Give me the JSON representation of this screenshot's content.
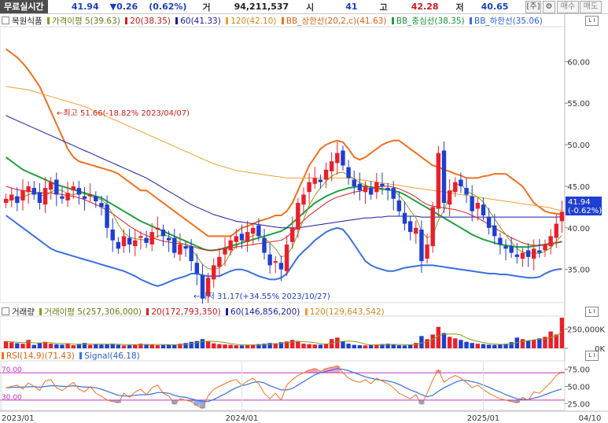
{
  "header": {
    "live_label": "무료실시간",
    "price": "41.94",
    "change": "▼0.26",
    "change_pct": "(0.62%)",
    "volume_label": "거",
    "volume": "94,211,537",
    "open_label": "시",
    "open": "41",
    "high_label": "고",
    "high": "42.28",
    "low_label": "저",
    "low": "40.65",
    "period_btn": "[주]",
    "settings_btn": "⚙",
    "buy_btn": "매수",
    "sell_btn": "매도"
  },
  "price_legend": {
    "name": "목원식품",
    "ma5": "가격이평 5(39.63)",
    "ma20": "20(38.35)",
    "ma60": "60(41.33)",
    "ma120": "120(42.10)",
    "bb_up": "BB_상한선(20,2,c)(41.63)",
    "bb_mid": "BB_중심선(38.35)",
    "bb_low": "BB_하한선(35.06)"
  },
  "volume_legend": {
    "name": "거래량",
    "vma5": "거래이평 5(257,306,000)",
    "vma20": "20(172,793,350)",
    "vma60": "60(146,856,200)",
    "vma120": "120(129,643,542)"
  },
  "rsi_legend": {
    "rsi": "RSI(14,9)(71.43)",
    "signal": "Signal(46.18)"
  },
  "annotations": {
    "high": "최고 51.66(-18.82% 2023/04/07)",
    "low": "최저 31.17(+34.55% 2023/10/27)",
    "last_price": "41.94",
    "last_pct": "(-0.62%)",
    "rsi_upper": "70.00",
    "rsi_lower": "30.00"
  },
  "colors": {
    "up": "#e8202b",
    "down": "#1e3fd0",
    "ma5": "#8a9a1a",
    "ma20": "#d42020",
    "ma60": "#1a1aa0",
    "ma120": "#f0a030",
    "bb_up": "#f07020",
    "bb_mid": "#20a040",
    "bb_low": "#3a6fe0",
    "rsi": "#f07020",
    "signal": "#3a6fe0",
    "guide": "#c030c0"
  },
  "chart_data": [
    {
      "type": "candlestick",
      "x_labels": [
        "2023/01",
        "2024/01",
        "2025/01",
        "04/10"
      ],
      "y_ticks": [
        35,
        40,
        45,
        50,
        55,
        60
      ],
      "ylim": [
        31,
        64
      ],
      "last_value": 41.94,
      "high": 51.66,
      "low": 31.17,
      "close_series": [
        43.5,
        44,
        43,
        44.5,
        45,
        44,
        43,
        44.8,
        45.5,
        44,
        43.5,
        44.2,
        45,
        44,
        43.5,
        44,
        43.2,
        42.5,
        40,
        38.5,
        37.5,
        39,
        38,
        38.5,
        39,
        38.2,
        39.5,
        40,
        39,
        38.5,
        37,
        38,
        37.5,
        36,
        34.5,
        31.5,
        34,
        35.5,
        36.5,
        37.5,
        38.5,
        39,
        38.5,
        39.5,
        40,
        39,
        37,
        35.5,
        36,
        35,
        38,
        40,
        43,
        44,
        45.5,
        46,
        45.5,
        47,
        48,
        49,
        47.5,
        46,
        45,
        44.5,
        45,
        44,
        45.5,
        45,
        44.5,
        43.5,
        42,
        40.5,
        39.5,
        40,
        36,
        38,
        42.5,
        49,
        43,
        44.5,
        45.5,
        45,
        44,
        42,
        43,
        41.5,
        40,
        39,
        38,
        37.5,
        37,
        36.5,
        37,
        36.5,
        37.5,
        37,
        38,
        39,
        40.5,
        41.94
      ],
      "ma5": [
        43,
        43.5,
        43.6,
        43.7,
        44,
        44.2,
        44,
        43.8,
        44.3,
        44.6,
        44.5,
        44.1,
        44,
        44.2,
        44.1,
        43.8,
        43.6,
        43.4,
        42.8,
        41.7,
        40.4,
        39.4,
        38.9,
        38.7,
        38.6,
        38.5,
        38.7,
        39,
        39.1,
        39,
        38.6,
        38.2,
        38,
        37.4,
        36.6,
        35.6,
        35.1,
        35,
        35.2,
        35.8,
        37,
        37.8,
        38.3,
        38.7,
        39.1,
        39.2,
        38.8,
        38.2,
        37.5,
        36.5,
        36.7,
        37.7,
        39.3,
        41,
        42.7,
        43.9,
        44.8,
        45.6,
        46.2,
        46.6,
        46.7,
        46.3,
        45.9,
        45.4,
        45.2,
        44.8,
        44.7,
        44.6,
        44.6,
        44.5,
        43.9,
        43.1,
        42.1,
        41.2,
        39.6,
        38.8,
        39.1,
        40.9,
        42.1,
        43.9,
        45,
        45.4,
        44.4,
        44.1,
        43.7,
        43.1,
        42.1,
        41.1,
        40.1,
        39.2,
        38.3,
        37.5,
        37.1,
        36.9,
        37,
        36.9,
        37.2,
        37.6,
        38.4,
        39.1
      ],
      "ma20": [
        45,
        44.8,
        44.6,
        44.5,
        44.4,
        44.3,
        44.2,
        44.2,
        44.2,
        44.1,
        44,
        43.9,
        43.8,
        43.6,
        43.4,
        43.1,
        42.8,
        42.5,
        42.1,
        41.7,
        41.2,
        40.7,
        40.2,
        39.8,
        39.4,
        39.1,
        38.8,
        38.6,
        38.4,
        38.3,
        38.2,
        38.1,
        38,
        37.8,
        37.6,
        37.4,
        37.3,
        37.3,
        37.4,
        37.5,
        37.6,
        37.7,
        37.8,
        37.9,
        38,
        38.1,
        38.2,
        38.3,
        38.4,
        38.5,
        38.9,
        39.5,
        40.2,
        40.9,
        41.5,
        42,
        42.5,
        43,
        43.4,
        43.7,
        43.9,
        44.1,
        44.3,
        44.4,
        44.6,
        44.8,
        44.9,
        45,
        45,
        44.9,
        44.7,
        44.4,
        44.1,
        43.7,
        43.2,
        42.8,
        42.6,
        42.5,
        42.4,
        42.3,
        42.2,
        42,
        41.8,
        41.5,
        41.2,
        40.8,
        40.4,
        40,
        39.6,
        39.2,
        38.8,
        38.5,
        38.2,
        38,
        37.9,
        37.9,
        38,
        38.1,
        38.2,
        38.35
      ],
      "ma60": [
        53.5,
        53.2,
        52.9,
        52.6,
        52.3,
        52,
        51.7,
        51.4,
        51.1,
        50.8,
        50.5,
        50.2,
        49.9,
        49.6,
        49.3,
        49,
        48.7,
        48.4,
        48.1,
        47.8,
        47.5,
        47.2,
        46.9,
        46.6,
        46.3,
        46,
        45.6,
        45.2,
        44.8,
        44.4,
        44,
        43.6,
        43.2,
        42.8,
        42.5,
        42.2,
        41.9,
        41.6,
        41.4,
        41.2,
        41,
        40.8,
        40.7,
        40.6,
        40.5,
        40.4,
        40.3,
        40.2,
        40.1,
        40,
        40,
        40,
        40,
        40.1,
        40.2,
        40.3,
        40.4,
        40.5,
        40.6,
        40.7,
        40.8,
        40.9,
        41,
        41.1,
        41.2,
        41.2,
        41.3,
        41.3,
        41.4,
        41.4,
        41.4,
        41.4,
        41.4,
        41.4,
        41.3,
        41.3,
        41.3,
        41.3,
        41.3,
        41.3,
        41.3,
        41.3,
        41.3,
        41.3,
        41.3,
        41.3,
        41.3,
        41.3,
        41.3,
        41.3,
        41.3,
        41.3,
        41.3,
        41.3,
        41.3,
        41.3,
        41.3,
        41.3,
        41.3,
        41.33
      ],
      "ma120": [
        57,
        56.9,
        56.8,
        56.7,
        56.6,
        56.4,
        56.2,
        56,
        55.8,
        55.6,
        55.4,
        55.2,
        55,
        54.8,
        54.6,
        54.3,
        54,
        53.7,
        53.4,
        53.1,
        52.8,
        52.5,
        52.2,
        51.9,
        51.6,
        51.3,
        51,
        50.7,
        50.4,
        50.1,
        49.8,
        49.5,
        49.2,
        48.9,
        48.6,
        48.3,
        48,
        47.7,
        47.5,
        47.3,
        47.1,
        46.9,
        46.8,
        46.7,
        46.6,
        46.5,
        46.4,
        46.3,
        46.2,
        46.1,
        46,
        46,
        46,
        46,
        46,
        46,
        46,
        46,
        46,
        46,
        46,
        46,
        45.9,
        45.8,
        45.7,
        45.6,
        45.5,
        45.4,
        45.3,
        45.2,
        45.1,
        45,
        44.9,
        44.8,
        44.7,
        44.6,
        44.5,
        44.4,
        44.3,
        44.2,
        44.1,
        44,
        43.9,
        43.8,
        43.7,
        43.6,
        43.5,
        43.4,
        43.3,
        43.2,
        43.1,
        43,
        42.9,
        42.8,
        42.7,
        42.6,
        42.5,
        42.4,
        42.2,
        42.1
      ],
      "bb_up": [
        61.5,
        61,
        60.5,
        59.8,
        59,
        58,
        57,
        55.5,
        54,
        52.5,
        51,
        49.5,
        48.5,
        48,
        47.8,
        47.6,
        47.4,
        47.2,
        47,
        46.8,
        46.5,
        46,
        45.5,
        45,
        44.5,
        44.5,
        44,
        43.5,
        43,
        42.5,
        42,
        41.5,
        41,
        40.5,
        40,
        39.5,
        39,
        39,
        39,
        39,
        39,
        39.5,
        40,
        40.2,
        40.5,
        40.8,
        41,
        41.2,
        41.5,
        41.5,
        42,
        43,
        44.5,
        46,
        47.5,
        48.5,
        49.5,
        50,
        50.3,
        50.5,
        50.3,
        49.5,
        48.5,
        48.2,
        48.5,
        49,
        49.5,
        50,
        50.3,
        50.5,
        50.5,
        50,
        49.5,
        49,
        48.5,
        48,
        47.5,
        47.3,
        47,
        46.8,
        46.5,
        46.3,
        46,
        46,
        46,
        46.2,
        46.3,
        46.5,
        46.5,
        46.5,
        46,
        45.5,
        45,
        44,
        43,
        42.5,
        42,
        41.8,
        41.7,
        41.63
      ],
      "bb_mid": [
        48.5,
        48,
        47.5,
        47,
        46.7,
        46.4,
        46.1,
        45.8,
        45.5,
        45.2,
        45,
        44.8,
        44.6,
        44.4,
        44.2,
        44,
        43.8,
        43.6,
        43.2,
        42.8,
        42.4,
        42,
        41.6,
        41.2,
        40.8,
        40.5,
        40.2,
        39.9,
        39.6,
        39.3,
        39,
        38.7,
        38.4,
        38.1,
        37.8,
        37.5,
        37.3,
        37.3,
        37.4,
        37.6,
        37.8,
        38,
        38.2,
        38.4,
        38.6,
        38.8,
        39,
        39.2,
        39.4,
        39.6,
        40,
        40.6,
        41.2,
        41.8,
        42.4,
        43,
        43.4,
        43.8,
        44.1,
        44.4,
        44.6,
        44.8,
        44.9,
        45,
        45,
        44.9,
        44.8,
        44.7,
        44.6,
        44.5,
        44.3,
        44,
        43.6,
        43.2,
        42.8,
        42.4,
        42,
        41.6,
        41.2,
        40.8,
        40.4,
        40,
        39.6,
        39.2,
        38.9,
        38.6,
        38.4,
        38.2,
        38,
        37.9,
        37.8,
        37.7,
        37.7,
        37.7,
        37.8,
        37.9,
        38,
        38.1,
        38.2,
        38.35
      ],
      "bb_low": [
        41.5,
        41,
        40.5,
        40,
        39.5,
        39,
        38.5,
        38,
        37.5,
        37.2,
        37,
        36.8,
        36.6,
        36.4,
        36.2,
        36,
        35.8,
        35.6,
        35.4,
        35.2,
        35,
        34.8,
        34.5,
        34.2,
        33.8,
        33.5,
        33.2,
        33,
        33.2,
        33.5,
        33.8,
        34,
        34.2,
        34.5,
        34.5,
        34.3,
        34.2,
        34.2,
        34.2,
        34.5,
        34.8,
        35,
        35,
        34.8,
        34.5,
        34.2,
        34,
        33.8,
        33.8,
        34,
        34.5,
        35.5,
        36.5,
        37.2,
        37.8,
        38.5,
        39,
        39.5,
        39.8,
        40,
        39.8,
        39,
        38,
        37,
        36,
        35.5,
        35.2,
        35,
        34.8,
        34.8,
        35,
        35.2,
        35.3,
        35.4,
        35.5,
        35.5,
        35.5,
        35.4,
        35.3,
        35.2,
        35.1,
        35,
        34.9,
        34.8,
        34.7,
        34.6,
        34.5,
        34.5,
        34.4,
        34.4,
        34.3,
        34.2,
        34.1,
        34,
        34,
        34.1,
        34.5,
        34.8,
        35,
        35.06
      ]
    },
    {
      "type": "bar",
      "title": "거래량",
      "y_ticks": [
        "250,000K",
        "0K"
      ],
      "ylim": [
        0,
        400000
      ],
      "values": [
        92000,
        78000,
        66000,
        60000,
        110000,
        45000,
        70000,
        85000,
        60000,
        52000,
        48000,
        65000,
        40000,
        58000,
        70000,
        45000,
        52000,
        48000,
        55000,
        60000,
        45000,
        38000,
        42000,
        50000,
        60000,
        55000,
        46000,
        40000,
        44000,
        52000,
        48000,
        60000,
        70000,
        85000,
        95000,
        120000,
        90000,
        65000,
        55000,
        50000,
        46000,
        40000,
        38000,
        42000,
        48000,
        55000,
        60000,
        70000,
        65000,
        80000,
        90000,
        110000,
        95000,
        60000,
        55000,
        50000,
        48000,
        60000,
        120000,
        140000,
        90000,
        60000,
        45000,
        40000,
        38000,
        42000,
        50000,
        55000,
        60000,
        48000,
        40000,
        38000,
        45000,
        70000,
        160000,
        120000,
        180000,
        280000,
        200000,
        150000,
        130000,
        110000,
        85000,
        70000,
        60000,
        55000,
        48000,
        45000,
        50000,
        60000,
        80000,
        140000,
        120000,
        100000,
        110000,
        130000,
        150000,
        220000,
        180000,
        400000
      ]
    },
    {
      "type": "line",
      "title": "RSI",
      "y_ticks": [
        25,
        50,
        75
      ],
      "ylim": [
        15,
        85
      ],
      "guides": [
        70,
        30
      ],
      "rsi": [
        48,
        50,
        52,
        46,
        55,
        50,
        44,
        58,
        60,
        48,
        44,
        50,
        56,
        46,
        42,
        50,
        40,
        36,
        30,
        28,
        26,
        40,
        34,
        42,
        46,
        38,
        48,
        52,
        40,
        36,
        24,
        32,
        30,
        28,
        22,
        18,
        36,
        46,
        50,
        54,
        58,
        60,
        52,
        58,
        62,
        54,
        40,
        32,
        40,
        30,
        52,
        60,
        66,
        70,
        74,
        76,
        72,
        76,
        78,
        80,
        70,
        62,
        58,
        56,
        60,
        54,
        62,
        58,
        54,
        48,
        40,
        36,
        32,
        38,
        24,
        40,
        60,
        74,
        56,
        62,
        66,
        62,
        56,
        48,
        52,
        46,
        40,
        36,
        32,
        30,
        28,
        26,
        34,
        30,
        42,
        40,
        48,
        56,
        66,
        71.43
      ],
      "signal": [
        48,
        48.5,
        49,
        49,
        49.5,
        49.5,
        49,
        50,
        51,
        51,
        50,
        50,
        51,
        50,
        49,
        49,
        48,
        46,
        43,
        40,
        37,
        36,
        36,
        37,
        38,
        38,
        39,
        41,
        41,
        40,
        37,
        35,
        34,
        32,
        30,
        28,
        28,
        31,
        35,
        39,
        44,
        48,
        51,
        53,
        56,
        57,
        55,
        51,
        48,
        45,
        45,
        47,
        52,
        57,
        62,
        67,
        70,
        72,
        74,
        76,
        75,
        73,
        70,
        67,
        64,
        62,
        60,
        59,
        58,
        56,
        53,
        49,
        45,
        42,
        38,
        35,
        37,
        43,
        48,
        52,
        56,
        59,
        59,
        57,
        55,
        52,
        49,
        45,
        42,
        38,
        35,
        32,
        31,
        31,
        33,
        35,
        38,
        41,
        44,
        46.18
      ]
    }
  ]
}
